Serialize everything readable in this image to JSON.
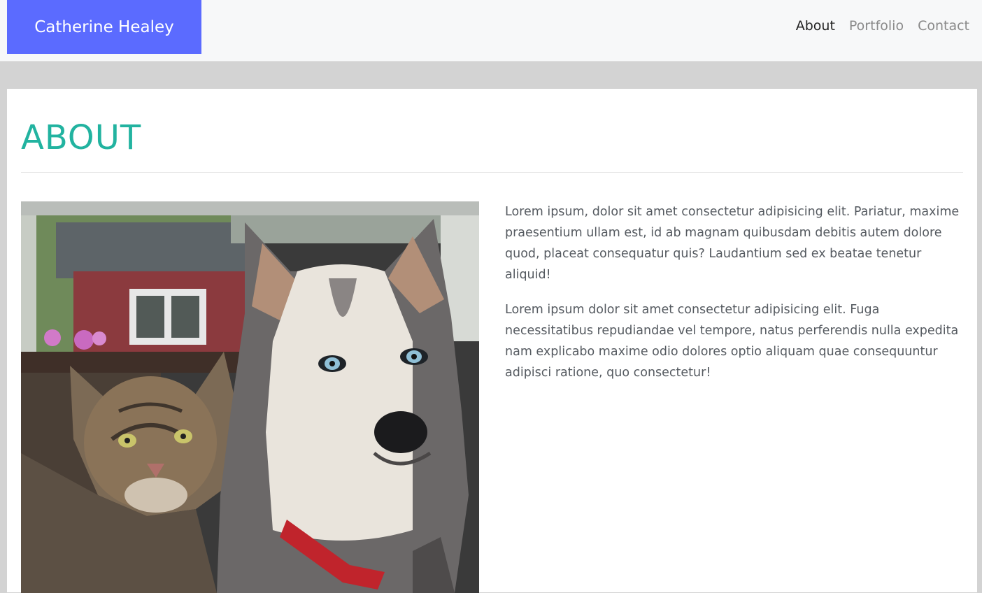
{
  "brand": {
    "name": "Catherine Healey"
  },
  "nav": {
    "items": [
      {
        "label": "About",
        "active": true
      },
      {
        "label": "Portfolio",
        "active": false
      },
      {
        "label": "Contact",
        "active": false
      }
    ]
  },
  "about": {
    "title": "ABOUT",
    "paragraphs": [
      "Lorem ipsum, dolor sit amet consectetur adipisicing elit. Pariatur, maxime praesentium ullam est, id ab magnam quibusdam debitis autem dolore quod, placeat consequatur quis? Laudantium sed ex beatae tenetur aliquid!",
      "Lorem ipsum dolor sit amet consectetur adipisicing elit. Fuga necessitatibus repudiandae vel tempore, natus perferendis nulla expedita nam explicabo maxime odio dolores optio aliquam quae consequuntur adipisci ratione, quo consectetur!"
    ]
  },
  "colors": {
    "brand_bg": "#5b6bff",
    "title": "#22b3a0",
    "page_bg": "#d3d3d3"
  }
}
